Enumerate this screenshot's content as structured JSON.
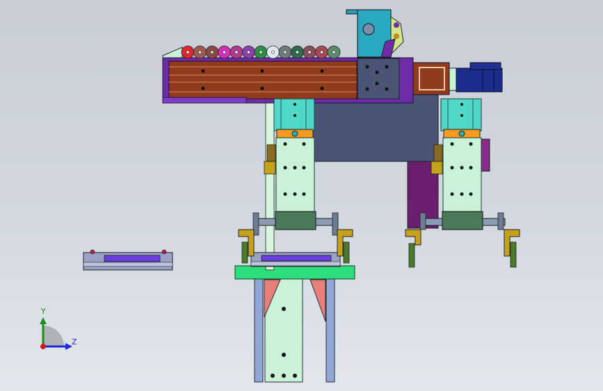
{
  "viewport": {
    "background_top": "#c9ced6",
    "background_bottom": "#e3e7ec"
  },
  "triad": {
    "y_label": "Y",
    "z_label": "Z",
    "y_color": "#178f1b",
    "z_color": "#1e2bd8",
    "x_color": "#d11b1b"
  },
  "palette": {
    "rail_brown": "#8e3b1e",
    "rail_purple": "#6e2ca8",
    "block_slate": "#4a5475",
    "cylinder_cyan": "#4fd8c7",
    "plate_mint": "#c9f2d9",
    "motor_blue": "#1c2c8c",
    "gripper_yellow": "#c5a21d",
    "base_green": "#2cde7c",
    "cutout_salmon": "#e7807a",
    "column_blue": "#8fa8d6"
  },
  "drag_chain": {
    "link_colors": [
      "#e0262f",
      "#9d5b52",
      "#8a4a44",
      "#d42fb8",
      "#b33a92",
      "#8d3fb0",
      "#2e8f43",
      "#dfeaf2",
      "#6b7c79",
      "#2f6a4c",
      "#8a4f5b",
      "#a64a52",
      "#5d8a6a"
    ]
  }
}
